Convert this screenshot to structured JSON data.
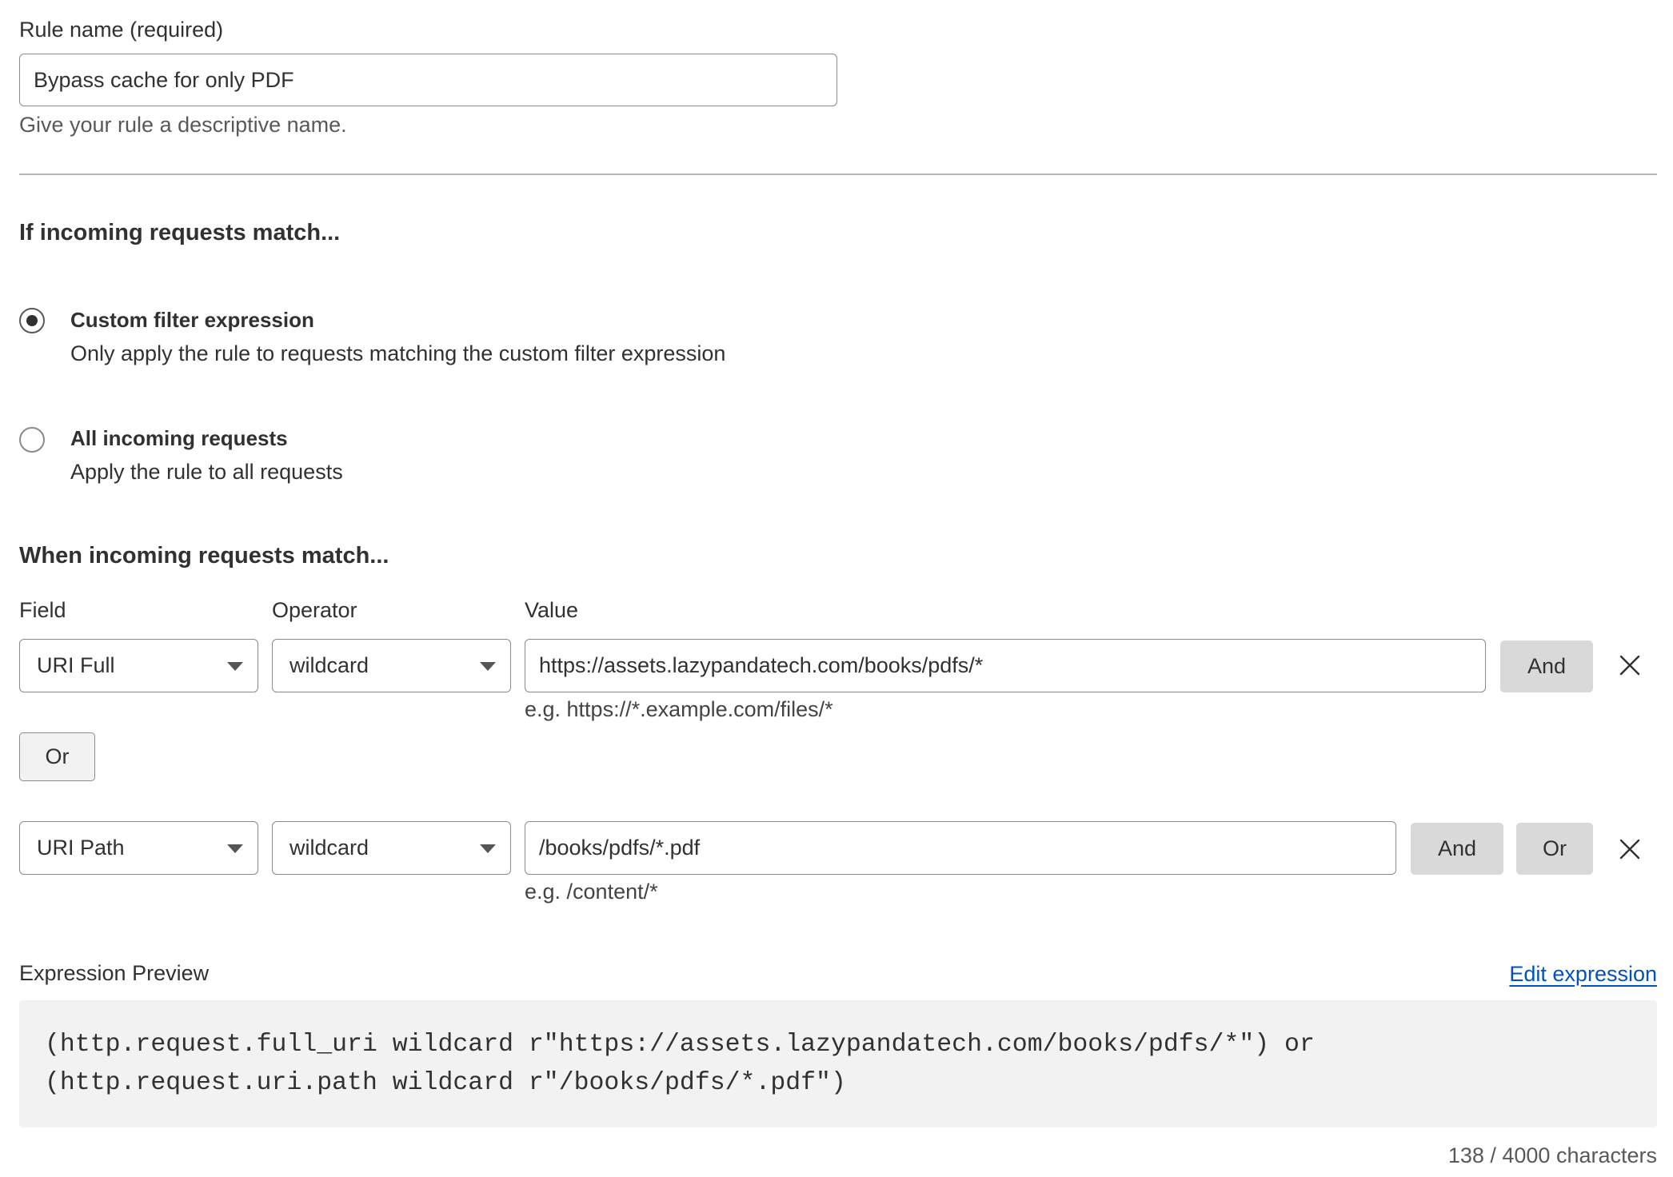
{
  "rule_name": {
    "label": "Rule name (required)",
    "value": "Bypass cache for only PDF",
    "help": "Give your rule a descriptive name."
  },
  "match_scope": {
    "heading": "If incoming requests match...",
    "options": [
      {
        "title": "Custom filter expression",
        "description": "Only apply the rule to requests matching the custom filter expression",
        "selected": true
      },
      {
        "title": "All incoming requests",
        "description": "Apply the rule to all requests",
        "selected": false
      }
    ]
  },
  "expression_builder": {
    "heading": "When incoming requests match...",
    "columns": {
      "field": "Field",
      "operator": "Operator",
      "value": "Value"
    },
    "group_separator": "Or",
    "rows": [
      {
        "field": "URI Full",
        "operator": "wildcard",
        "value": "https://assets.lazypandatech.com/books/pdfs/*",
        "hint": "e.g. https://*.example.com/files/*",
        "actions": [
          "And"
        ]
      },
      {
        "field": "URI Path",
        "operator": "wildcard",
        "value": "/books/pdfs/*.pdf",
        "hint": "e.g. /content/*",
        "actions": [
          "And",
          "Or"
        ]
      }
    ]
  },
  "preview": {
    "label": "Expression Preview",
    "edit_link": "Edit expression",
    "lines": [
      "(http.request.full_uri wildcard r\"https://assets.lazypandatech.com/books/pdfs/*\") or",
      "(http.request.uri.path wildcard r\"/books/pdfs/*.pdf\")"
    ],
    "char_count": "138 / 4000 characters"
  },
  "icons": {
    "dropdown": "chevron-down-icon",
    "remove_row": "close-icon",
    "radio": "radio-icon"
  },
  "colors": {
    "text": "#313131",
    "muted": "#595959",
    "link": "#0051c3",
    "border": "#8a8a8a",
    "button_bg": "#d9d9d9",
    "preview_bg": "#f2f2f2",
    "divider": "#b6b6b6"
  }
}
